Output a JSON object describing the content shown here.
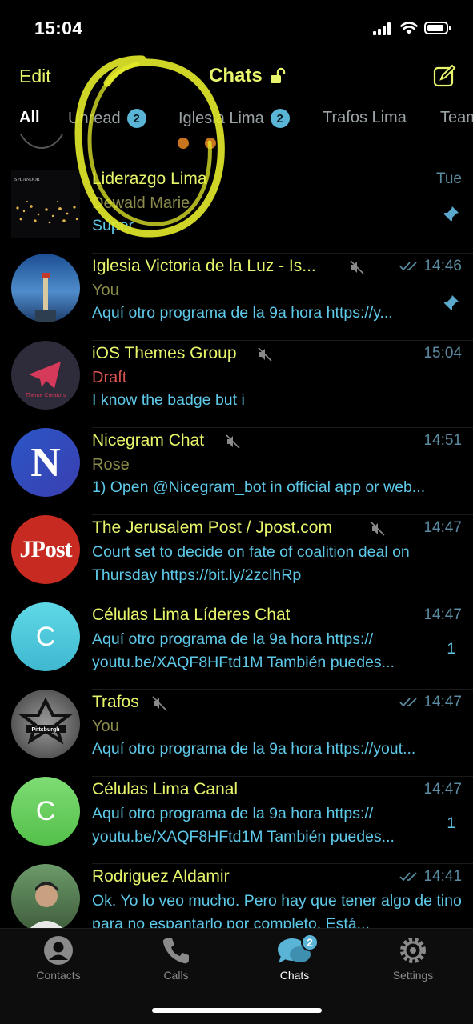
{
  "status": {
    "time": "15:04"
  },
  "nav": {
    "edit": "Edit",
    "title": "Chats"
  },
  "tabs": [
    {
      "label": "All",
      "badge": ""
    },
    {
      "label": "Unread",
      "badge": "2"
    },
    {
      "label": "Iglesia Lima",
      "badge": "2"
    },
    {
      "label": "Trafos Lima",
      "badge": ""
    },
    {
      "label": "Team",
      "badge": ""
    }
  ],
  "chats": [
    {
      "name": "Liderazgo Lima",
      "sender": "Dewald Marie",
      "message": "Súper",
      "time": "Tue",
      "pinned": true
    },
    {
      "name": "Iglesia Victoria de la Luz - Is...",
      "sender": "You",
      "message": "Aquí otro programa de la 9a hora https://y...",
      "time": "14:46",
      "muted": true,
      "read": true,
      "pinned": true
    },
    {
      "name": "iOS Themes Group",
      "sender": "Draft",
      "message": "I know the badge but i",
      "time": "15:04",
      "muted": true,
      "avatar_text": "Theme Creators"
    },
    {
      "name": "Nicegram Chat",
      "sender": "Rose",
      "message": "1) Open @Nicegram_bot in official app or web...",
      "time": "14:51",
      "muted": true,
      "avatar_text": "N"
    },
    {
      "name": "The Jerusalem Post / Jpost.com",
      "message": "Court set to decide on fate of coalition deal on Thursday https://bit.ly/2zclhRp",
      "time": "14:47",
      "muted": true,
      "avatar_text": "JPost"
    },
    {
      "name": "Células Lima Líderes Chat",
      "message": "Aquí otro programa de la 9a hora https:// youtu.be/XAQF8HFtd1M También puedes...",
      "time": "14:47",
      "unread": "1",
      "avatar_text": "C"
    },
    {
      "name": "Trafos",
      "sender": "You",
      "message": "Aquí otro programa de la 9a hora https://yout...",
      "time": "14:47",
      "muted": true,
      "read": true,
      "avatar_text": "Pittsburgh"
    },
    {
      "name": "Células Lima Canal",
      "message": "Aquí otro programa de la 9a hora https:// youtu.be/XAQF8HFtd1M También puedes...",
      "time": "14:47",
      "unread": "1",
      "avatar_text": "C"
    },
    {
      "name": "Rodriguez Aldamir",
      "message": "Ok. Yo lo veo mucho. Pero hay que tener algo de tino para no espantarlo por completo. Está...",
      "time": "14:41",
      "read": true
    }
  ],
  "tabbar": [
    {
      "label": "Contacts",
      "icon": "contacts-icon"
    },
    {
      "label": "Calls",
      "icon": "phone-icon"
    },
    {
      "label": "Chats",
      "icon": "chats-icon",
      "badge": "2"
    },
    {
      "label": "Settings",
      "icon": "gear-icon"
    }
  ],
  "colors": {
    "accent": "#e8f56b",
    "message": "#5ec8e8",
    "badge": "#5ab4d6",
    "background": "#000000"
  }
}
